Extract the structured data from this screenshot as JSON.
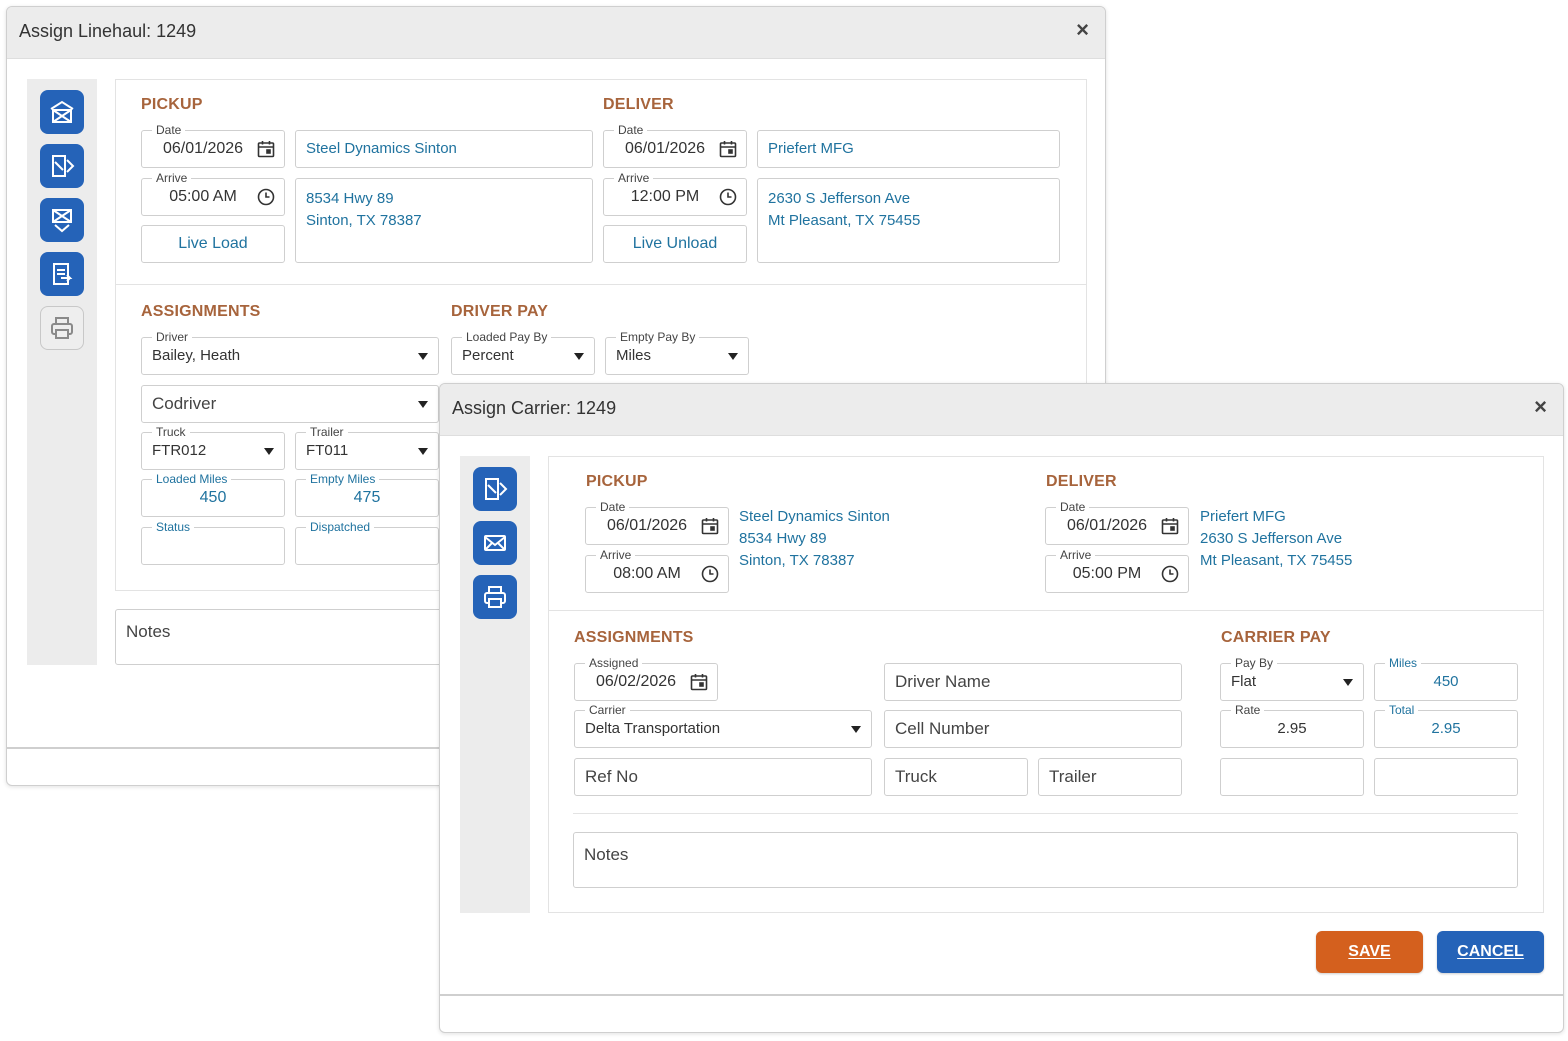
{
  "linehaul": {
    "title": "Assign Linehaul: 1249",
    "close": "×",
    "pickup": {
      "title": "PICKUP",
      "date_label": "Date",
      "date": "06/01/2026",
      "arrive_label": "Arrive",
      "arrive": "05:00 AM",
      "load_type": "Live Load",
      "location": "Steel Dynamics Sinton",
      "address_line1": "8534 Hwy 89",
      "address_line2": "Sinton, TX 78387"
    },
    "deliver": {
      "title": "DELIVER",
      "date_label": "Date",
      "date": "06/01/2026",
      "arrive_label": "Arrive",
      "arrive": "12:00 PM",
      "load_type": "Live Unload",
      "location": "Priefert MFG",
      "address_line1": "2630 S Jefferson Ave",
      "address_line2": "Mt Pleasant, TX 75455"
    },
    "assignments": {
      "title": "ASSIGNMENTS",
      "driver_label": "Driver",
      "driver": "Bailey, Heath",
      "codriver_placeholder": "Codriver",
      "truck_label": "Truck",
      "truck": "FTR012",
      "trailer_label": "Trailer",
      "trailer": "FT011",
      "loaded_miles_label": "Loaded Miles",
      "loaded_miles": "450",
      "empty_miles_label": "Empty Miles",
      "empty_miles": "475",
      "status_label": "Status",
      "status": "",
      "dispatched_label": "Dispatched",
      "dispatched": ""
    },
    "driver_pay": {
      "title": "DRIVER PAY",
      "loaded_pay_label": "Loaded Pay By",
      "loaded_pay": "Percent",
      "empty_pay_label": "Empty Pay By",
      "empty_pay": "Miles"
    },
    "notes_placeholder": "Notes"
  },
  "carrier": {
    "title": "Assign Carrier: 1249",
    "close": "×",
    "pickup": {
      "title": "PICKUP",
      "date_label": "Date",
      "date": "06/01/2026",
      "arrive_label": "Arrive",
      "arrive": "08:00 AM",
      "location": "Steel Dynamics Sinton",
      "address_line1": "8534 Hwy 89",
      "address_line2": "Sinton, TX 78387"
    },
    "deliver": {
      "title": "DELIVER",
      "date_label": "Date",
      "date": "06/01/2026",
      "arrive_label": "Arrive",
      "arrive": "05:00 PM",
      "location": "Priefert MFG",
      "address_line1": "2630 S Jefferson Ave",
      "address_line2": "Mt Pleasant, TX 75455"
    },
    "assignments": {
      "title": "ASSIGNMENTS",
      "assigned_label": "Assigned",
      "assigned": "06/02/2026",
      "carrier_label": "Carrier",
      "carrier": "Delta Transportation",
      "ref_no_placeholder": "Ref No",
      "driver_name_placeholder": "Driver Name",
      "cell_number_placeholder": "Cell Number",
      "truck_placeholder": "Truck",
      "trailer_placeholder": "Trailer"
    },
    "carrier_pay": {
      "title": "CARRIER PAY",
      "pay_by_label": "Pay By",
      "pay_by": "Flat",
      "miles_label": "Miles",
      "miles": "450",
      "rate_label": "Rate",
      "rate": "2.95",
      "total_label": "Total",
      "total": "2.95"
    },
    "notes_placeholder": "Notes",
    "save_label": "SAVE",
    "cancel_label": "CANCEL"
  },
  "colors": {
    "accent_blue": "#2563b8",
    "section_brown": "#a7643c",
    "link_teal": "#20739f",
    "save_orange": "#d4601e"
  }
}
